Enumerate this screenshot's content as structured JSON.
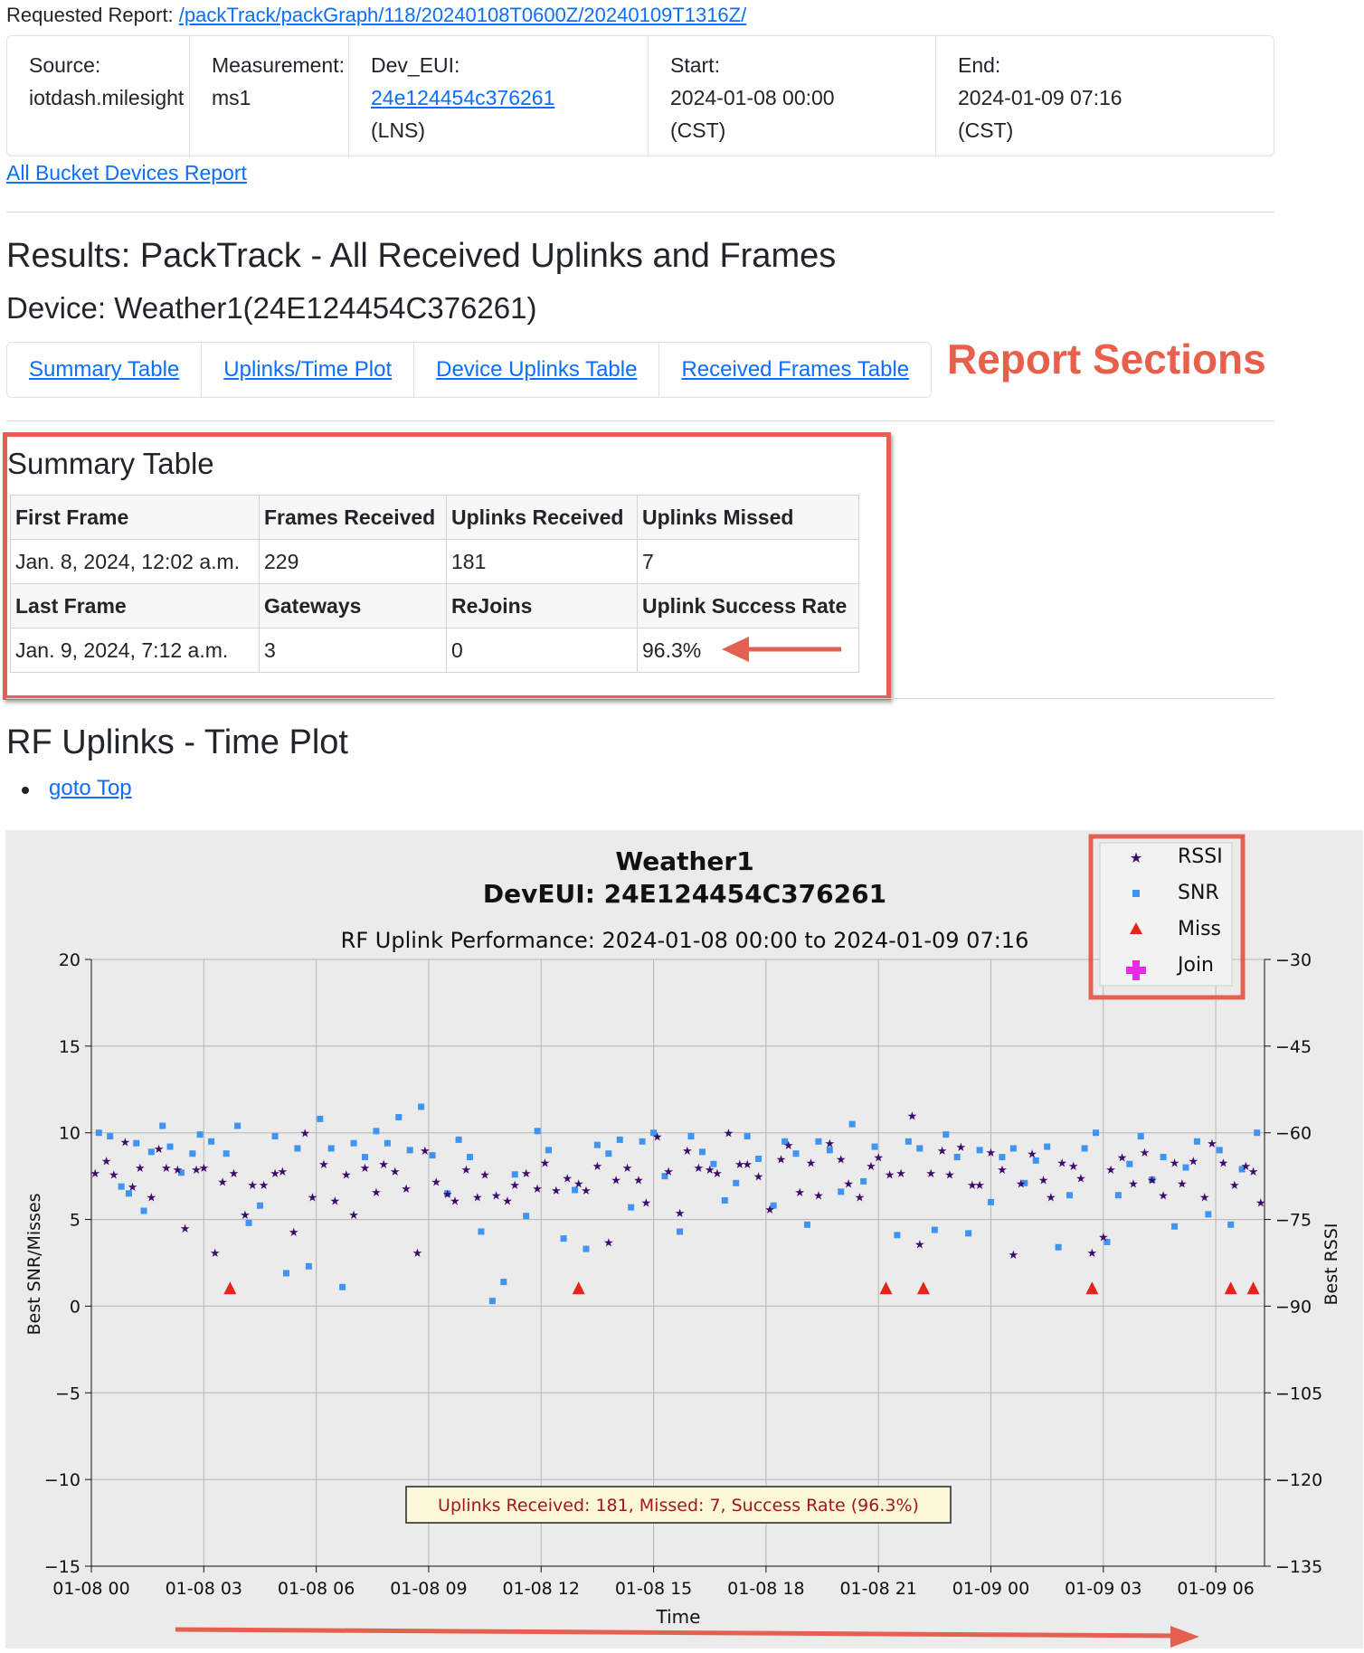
{
  "header": {
    "requested_label": "Requested Report:",
    "requested_link": "/packTrack/packGraph/118/20240108T0600Z/20240109T1316Z/"
  },
  "info": {
    "source_label": "Source:",
    "source_value": "iotdash.milesight",
    "measurement_label": "Measurement:",
    "measurement_value": "ms1",
    "deveui_label": "Dev_EUI:",
    "deveui_value": "24e124454c376261",
    "deveui_note": "(LNS)",
    "start_label": "Start:",
    "start_value": "2024-01-08 00:00",
    "start_tz": "(CST)",
    "end_label": "End:",
    "end_value": "2024-01-09 07:16",
    "end_tz": "(CST)"
  },
  "all_bucket_link": "All Bucket Devices Report",
  "results_title": "Results: PackTrack - All Received Uplinks and Frames",
  "device_title": "Device: Weather1(24E124454C376261)",
  "tabs": [
    "Summary Table",
    "Uplinks/Time Plot",
    "Device Uplinks Table",
    "Received Frames Table"
  ],
  "callout_sections": "Report Sections",
  "summary": {
    "title": "Summary Table",
    "row1_headers": [
      "First Frame",
      "Frames Received",
      "Uplinks Received",
      "Uplinks Missed"
    ],
    "row1_values": [
      "Jan. 8, 2024, 12:02 a.m.",
      "229",
      "181",
      "7"
    ],
    "row2_headers": [
      "Last Frame",
      "Gateways",
      "ReJoins",
      "Uplink Success Rate"
    ],
    "row2_values": [
      "Jan. 9, 2024, 7:12 a.m.",
      "3",
      "0",
      "96.3%"
    ]
  },
  "plot_section": {
    "title": "RF Uplinks - Time Plot",
    "goto_top": "goto Top"
  },
  "colors": {
    "rssi": "#3d0a6e",
    "snr": "#3f94ef",
    "miss": "#e8241a",
    "join": "#e82be8",
    "callout": "#e46050",
    "plot_bg": "#ebebeb"
  },
  "chart_data": {
    "type": "scatter",
    "title": "Weather1",
    "subtitle": "DevEUI: 24E124454C376261",
    "caption": "RF Uplink Performance: 2024-01-08 00:00 to 2024-01-09 07:16",
    "xlabel": "Time",
    "ylabel_left": "Best SNR/Misses",
    "ylabel_right": "Best RSSI",
    "xlim_hours": [
      0,
      31.3
    ],
    "ylim_left": [
      -15,
      20
    ],
    "ylim_right": [
      -135,
      -30
    ],
    "x_ticks": [
      "01-08 00",
      "01-08 03",
      "01-08 06",
      "01-08 09",
      "01-08 12",
      "01-08 15",
      "01-08 18",
      "01-08 21",
      "01-09 00",
      "01-09 03",
      "01-09 06"
    ],
    "y_ticks_left": [
      "20",
      "15",
      "10",
      "5",
      "0",
      "−5",
      "−10",
      "−15"
    ],
    "y_ticks_right": [
      "−30",
      "−45",
      "−60",
      "−75",
      "−90",
      "−105",
      "−120",
      "−135"
    ],
    "legend": [
      "RSSI",
      "SNR",
      "Miss",
      "Join"
    ],
    "legend_position": "top-right",
    "grid": true,
    "annotation": "Uplinks Received: 181, Missed: 7, Success Rate (96.3%)",
    "series": [
      {
        "name": "Miss",
        "x": [
          3.7,
          13.0,
          21.2,
          22.2,
          26.7,
          30.4,
          31.0
        ],
        "y": [
          1,
          1,
          1,
          1,
          1,
          1,
          1
        ]
      },
      {
        "name": "SNR",
        "x": [
          0.2,
          0.5,
          0.8,
          1.0,
          1.2,
          1.4,
          1.6,
          1.9,
          2.1,
          2.4,
          2.7,
          2.9,
          3.2,
          3.6,
          3.9,
          4.2,
          4.5,
          4.9,
          5.2,
          5.5,
          5.8,
          6.1,
          6.4,
          6.7,
          7.0,
          7.3,
          7.6,
          7.9,
          8.2,
          8.5,
          8.8,
          9.1,
          9.5,
          9.8,
          10.1,
          10.4,
          10.7,
          11.0,
          11.3,
          11.6,
          11.9,
          12.2,
          12.6,
          12.9,
          13.2,
          13.5,
          13.8,
          14.1,
          14.4,
          14.7,
          15.0,
          15.3,
          15.7,
          16.0,
          16.3,
          16.6,
          16.9,
          17.2,
          17.5,
          17.8,
          18.2,
          18.5,
          18.8,
          19.1,
          19.4,
          19.7,
          20.0,
          20.3,
          20.6,
          20.9,
          21.2,
          21.5,
          21.8,
          22.1,
          22.5,
          22.8,
          23.1,
          23.4,
          23.7,
          24.0,
          24.3,
          24.6,
          24.9,
          25.2,
          25.5,
          25.8,
          26.1,
          26.5,
          26.8,
          27.1,
          27.4,
          27.7,
          28.0,
          28.3,
          28.6,
          28.9,
          29.2,
          29.5,
          29.8,
          30.1,
          30.4,
          30.7,
          31.1
        ],
        "y": [
          10,
          9.8,
          6.9,
          6.5,
          9.4,
          5.5,
          8.9,
          10.4,
          9.2,
          7.7,
          8.8,
          9.9,
          9.5,
          8.8,
          10.4,
          4.8,
          5.8,
          9.8,
          1.9,
          9.1,
          2.3,
          10.8,
          9.1,
          1.1,
          9.4,
          8.6,
          10.1,
          9.4,
          10.9,
          9.0,
          11.5,
          8.7,
          6.5,
          9.6,
          8.6,
          4.3,
          0.3,
          1.4,
          7.6,
          5.2,
          10.1,
          9.0,
          3.9,
          6.7,
          3.3,
          9.3,
          8.8,
          9.6,
          5.7,
          9.5,
          10.0,
          7.5,
          4.3,
          9.8,
          8.9,
          8.2,
          6.1,
          7.1,
          9.8,
          8.5,
          5.8,
          9.5,
          8.8,
          4.7,
          9.5,
          9.0,
          6.6,
          10.5,
          7.2,
          9.2,
          0.9,
          4.1,
          9.5,
          9.1,
          4.4,
          9.9,
          8.6,
          4.2,
          9.0,
          6.0,
          8.6,
          9.1,
          7.1,
          8.4,
          9.2,
          3.4,
          6.4,
          9.1,
          10.0,
          3.7,
          6.4,
          8.2,
          9.8,
          7.3,
          8.6,
          4.6,
          8.0,
          9.5,
          5.3,
          9.0,
          4.7,
          7.9,
          10.0
        ]
      },
      {
        "name": "RSSI",
        "x": [
          0.1,
          0.4,
          0.6,
          0.9,
          1.1,
          1.3,
          1.6,
          1.8,
          2.0,
          2.3,
          2.5,
          2.8,
          3.0,
          3.3,
          3.5,
          3.8,
          4.1,
          4.3,
          4.6,
          4.9,
          5.1,
          5.4,
          5.7,
          5.9,
          6.2,
          6.5,
          6.8,
          7.0,
          7.3,
          7.6,
          7.8,
          8.1,
          8.4,
          8.7,
          8.9,
          9.2,
          9.5,
          9.7,
          10.0,
          10.3,
          10.5,
          10.8,
          11.1,
          11.3,
          11.6,
          11.9,
          12.1,
          12.4,
          12.7,
          13.0,
          13.2,
          13.5,
          13.8,
          14.0,
          14.3,
          14.6,
          14.8,
          15.1,
          15.4,
          15.7,
          15.9,
          16.2,
          16.5,
          16.7,
          17.0,
          17.3,
          17.5,
          17.8,
          18.1,
          18.4,
          18.6,
          18.9,
          19.2,
          19.4,
          19.7,
          20.0,
          20.2,
          20.5,
          20.8,
          21.0,
          21.3,
          21.6,
          21.9,
          22.1,
          22.4,
          22.7,
          22.9,
          23.2,
          23.5,
          23.7,
          24.0,
          24.3,
          24.6,
          24.8,
          25.1,
          25.4,
          25.6,
          25.9,
          26.2,
          26.4,
          26.7,
          27.0,
          27.2,
          27.5,
          27.8,
          28.1,
          28.3,
          28.6,
          28.9,
          29.1,
          29.4,
          29.7,
          29.9,
          30.2,
          30.5,
          30.8,
          31.0,
          31.2
        ],
        "y": [
          7.7,
          8.4,
          7.6,
          9.5,
          6.9,
          8.0,
          6.3,
          9.1,
          8.0,
          7.9,
          4.5,
          7.9,
          8.0,
          3.1,
          7.2,
          7.7,
          5.3,
          7.0,
          7.0,
          7.7,
          7.8,
          4.3,
          10.0,
          6.3,
          8.2,
          6.1,
          7.6,
          5.3,
          8.0,
          6.6,
          8.2,
          7.8,
          6.8,
          3.1,
          9.0,
          7.2,
          6.5,
          6.1,
          7.9,
          6.3,
          7.6,
          6.4,
          6.1,
          7.0,
          7.7,
          6.8,
          8.3,
          6.7,
          7.4,
          7.1,
          6.7,
          8.1,
          3.7,
          7.3,
          8.0,
          7.3,
          6.0,
          9.8,
          7.8,
          5.4,
          9.0,
          8.0,
          7.9,
          7.7,
          10.0,
          8.2,
          8.2,
          7.5,
          5.6,
          8.5,
          9.3,
          6.6,
          8.3,
          6.4,
          9.4,
          8.5,
          7.1,
          6.3,
          8.1,
          8.6,
          7.6,
          7.7,
          11.0,
          3.6,
          7.7,
          9.0,
          7.6,
          9.2,
          7.0,
          7.0,
          8.9,
          7.9,
          3.0,
          7.1,
          8.8,
          7.3,
          6.3,
          8.3,
          8.1,
          7.4,
          3.1,
          4.0,
          7.9,
          8.6,
          7.1,
          8.9,
          7.3,
          6.4,
          8.3,
          7.1,
          8.4,
          6.3,
          9.4,
          8.3,
          7.0,
          8.1,
          7.8,
          6.0
        ]
      }
    ]
  }
}
